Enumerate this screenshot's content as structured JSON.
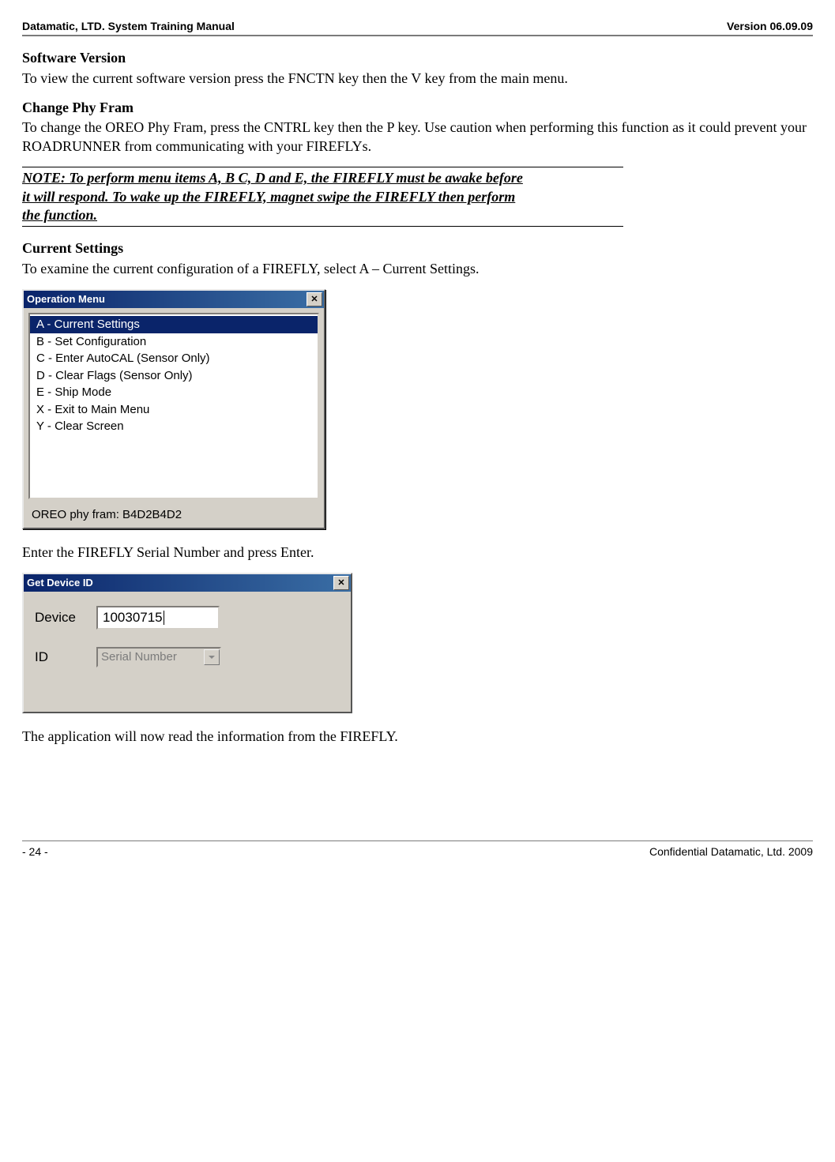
{
  "header": {
    "left": "Datamatic, LTD. System Training  Manual",
    "right": "Version 06.09.09"
  },
  "sections": {
    "sw_version_heading": "Software Version",
    "sw_version_body": "To view the current software version press the FNCTN key then the V key from the main menu.",
    "change_phy_heading": "Change Phy Fram",
    "change_phy_body": "To change the OREO Phy Fram, press the CNTRL key then the P key.  Use caution when performing this function as it could prevent your ROADRUNNER from communicating with your FIREFLYs.",
    "note_line1": "NOTE: To perform menu items A, B C, D and E, the FIREFLY must be awake before",
    "note_line2": "it will respond.  To wake up the FIREFLY, magnet swipe the FIREFLY then perform",
    "note_line3": "the function.",
    "curr_set_heading": "Current Settings",
    "curr_set_body": "To examine the current configuration of a FIREFLY, select A – Current Settings.",
    "enter_serial": "Enter the FIREFLY Serial Number and press Enter.",
    "app_read": "The application will now read the information from the FIREFLY."
  },
  "op_menu": {
    "title": "Operation Menu",
    "items": [
      "A - Current Settings",
      "B - Set Configuration",
      "C - Enter AutoCAL (Sensor Only)",
      "D - Clear Flags (Sensor Only)",
      "E - Ship Mode",
      "X - Exit to Main Menu",
      "Y - Clear Screen"
    ],
    "footer": "OREO phy fram: B4D2B4D2"
  },
  "get_device": {
    "title": "Get Device ID",
    "device_label": "Device",
    "device_value": "10030715",
    "id_label": "ID",
    "id_value": "Serial Number"
  },
  "footer": {
    "left": "- 24 -",
    "right": "Confidential Datamatic, Ltd. 2009"
  }
}
